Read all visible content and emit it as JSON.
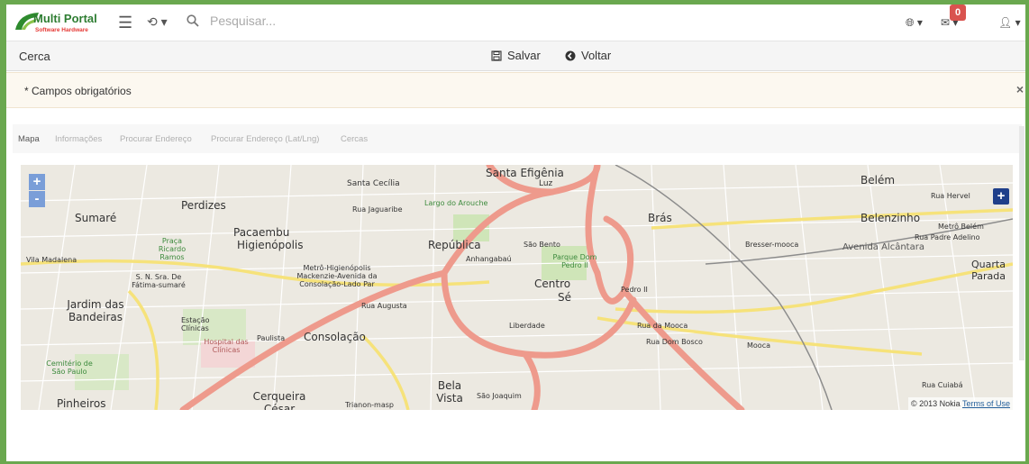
{
  "brand": {
    "name": "Multi Portal",
    "tagline": "Software Hardware"
  },
  "search": {
    "placeholder": "Pesquisar..."
  },
  "notifications": {
    "count": "0"
  },
  "toolbar": {
    "title": "Cerca",
    "save_label": "Salvar",
    "back_label": "Voltar"
  },
  "alert": {
    "text": "* Campos obrigatórios",
    "close": "×"
  },
  "tabs": [
    {
      "label": "Mapa",
      "active": true
    },
    {
      "label": "Informações",
      "active": false
    },
    {
      "label": "Procurar Endereço",
      "active": false
    },
    {
      "label": "Procurar Endereço (Lat/Lng)",
      "active": false
    },
    {
      "label": "Cercas",
      "active": false
    }
  ],
  "map": {
    "zoom_in": "+",
    "zoom_out": "-",
    "expand": "+",
    "copyright": "© 2013 Nokia",
    "terms": "Terms of Use",
    "labels": [
      "Santa Efigênia",
      "Luz",
      "Belém",
      "Santa Cecília",
      "Perdizes",
      "Sumaré",
      "Rua Jaguaribe",
      "Largo do Arouche",
      "Pacaembu",
      "Higienópolis",
      "República",
      "São Bento",
      "Brás",
      "Belenzinho",
      "Metrô Belém",
      "Bresser-mooca",
      "Rua Padre Adelino",
      "Praça Ricardo Ramos",
      "Vila Madalena",
      "Anhangabaú",
      "Parque Dom Pedro II",
      "Quarta Parada",
      "Metrô-Higienópolis Mackenzie-Avenida da Consolação-Lado Par",
      "S. N. Sra. De Fátima-sumaré",
      "Centro",
      "Sé",
      "Pedro II",
      "Jardim das Bandeiras",
      "Rua Augusta",
      "Estação Clínicas",
      "Liberdade",
      "Rua da Mooca",
      "Hospital das Clínicas",
      "Paulista",
      "Consolação",
      "Rua Dom Bosco",
      "Mooca",
      "Cemitério de São Paulo",
      "Bela Vista",
      "Pinheiros",
      "Cerqueira César",
      "São Joaquim",
      "Rua Cuiabá",
      "Rua Hervel",
      "Avenida Alcântara",
      "Trianon-masp"
    ]
  }
}
